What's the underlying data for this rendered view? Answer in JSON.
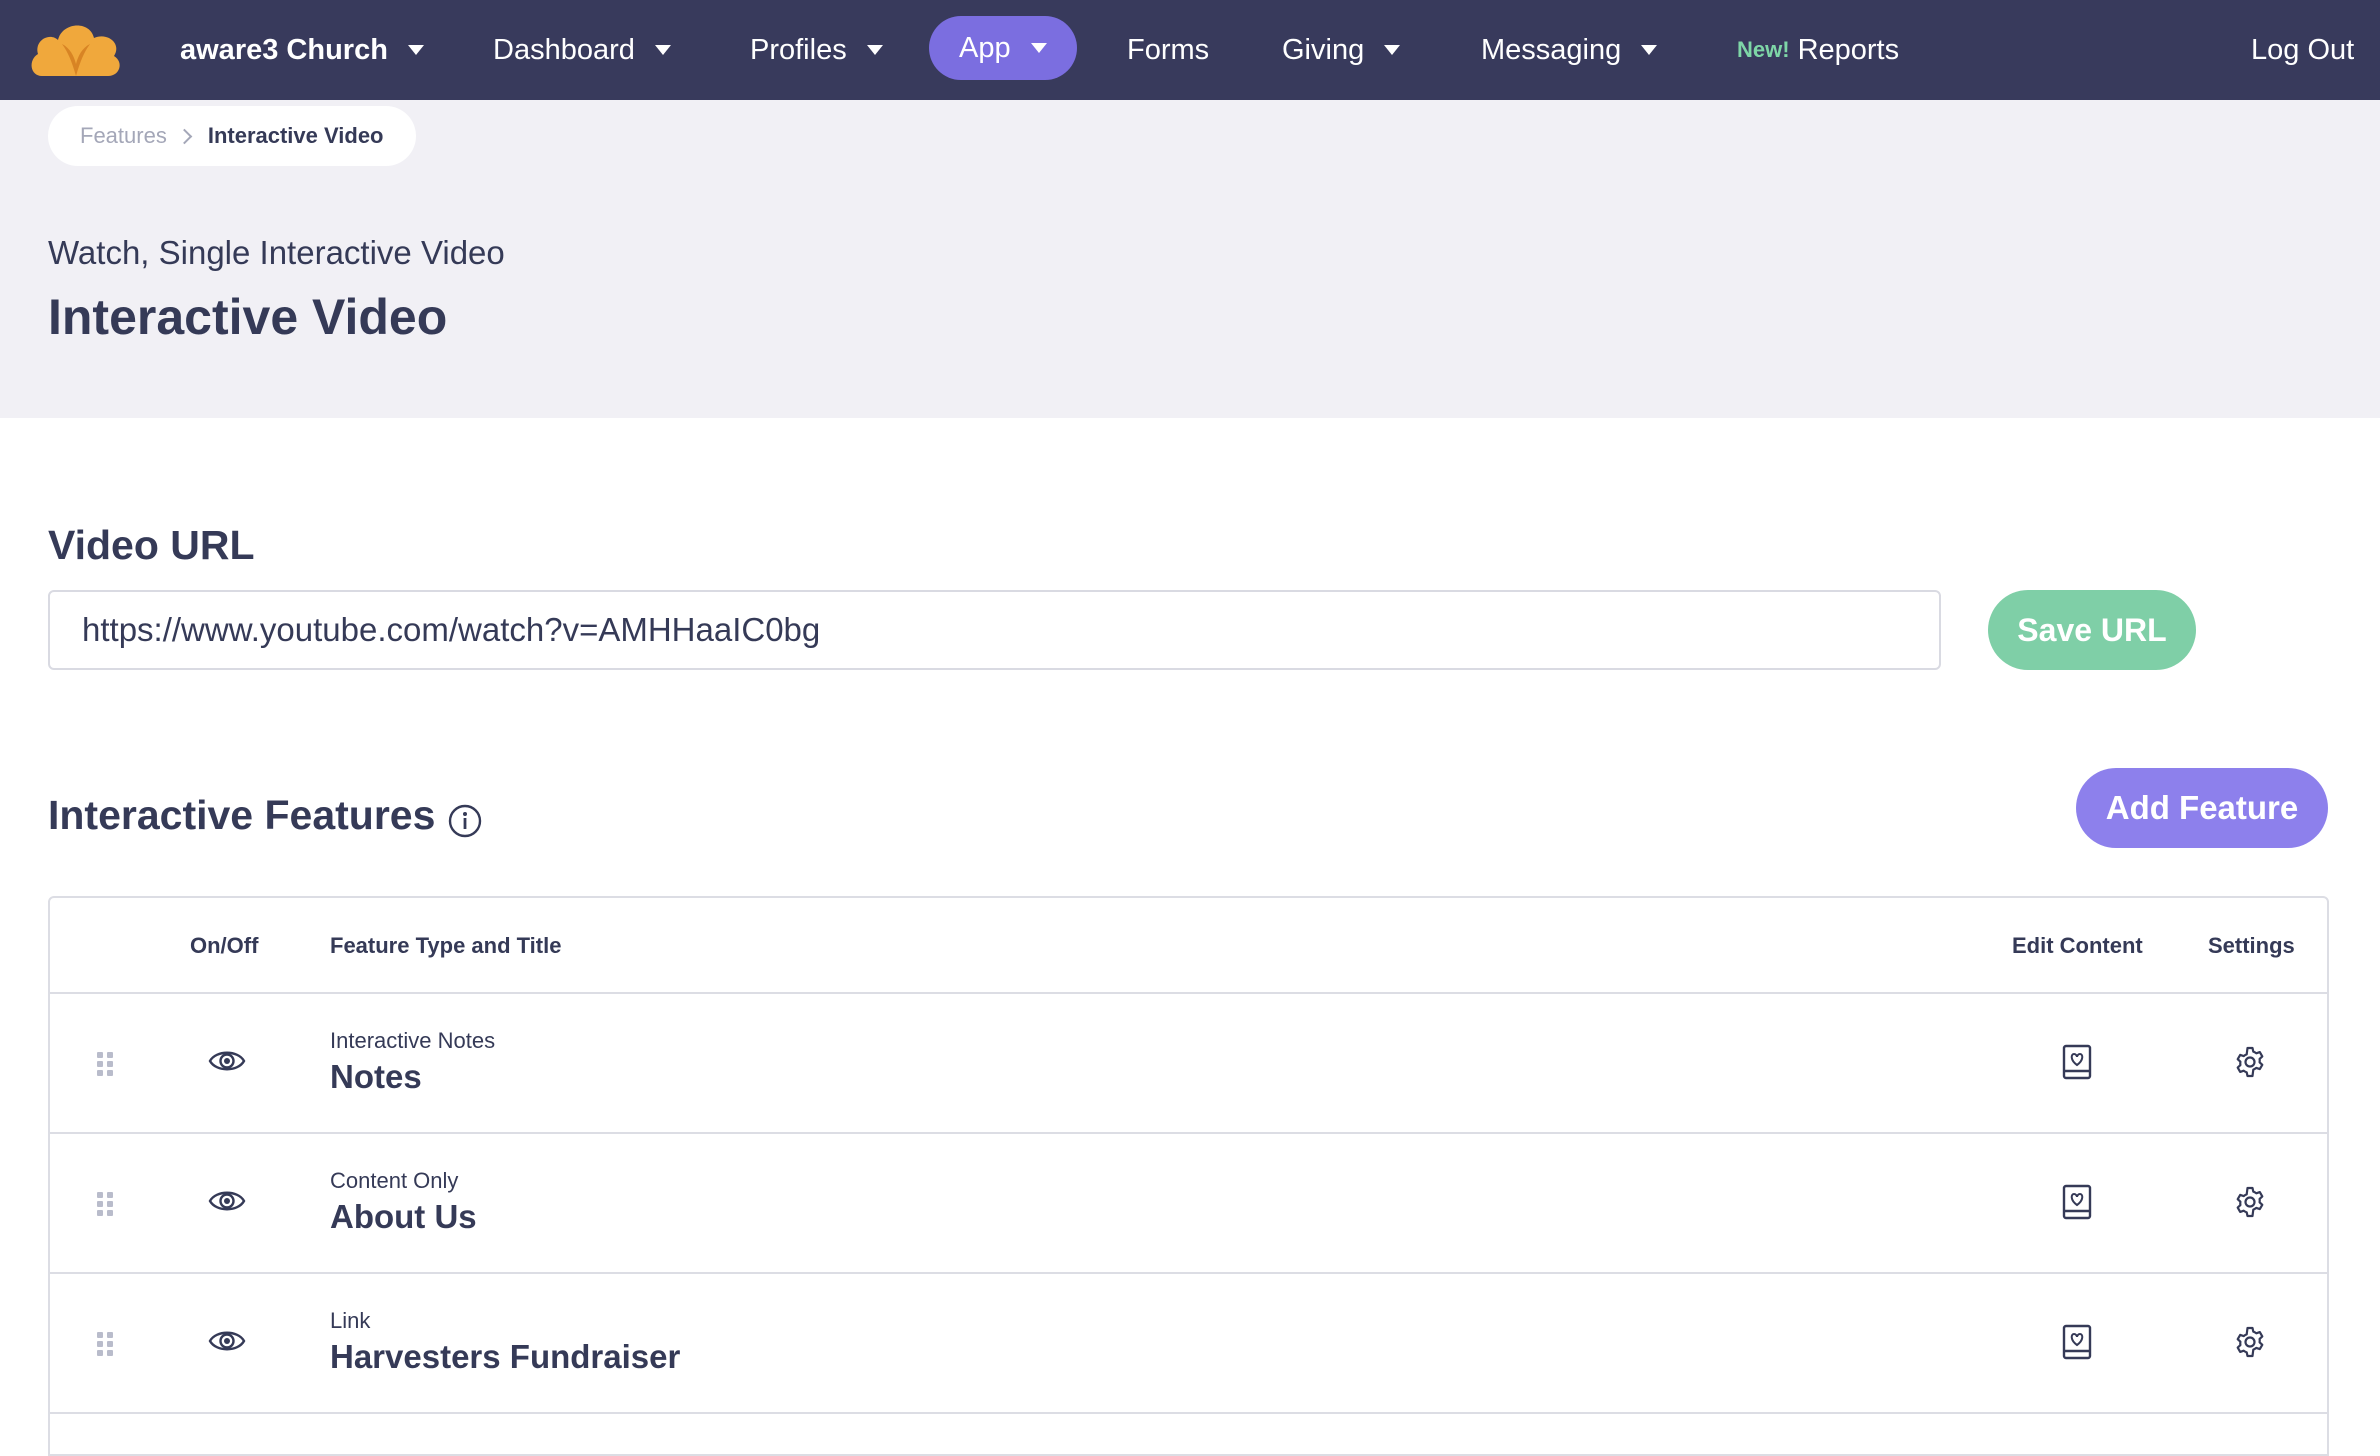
{
  "nav": {
    "church": "aware3 Church",
    "dashboard": "Dashboard",
    "profiles": "Profiles",
    "app": "App",
    "forms": "Forms",
    "giving": "Giving",
    "messaging": "Messaging",
    "new_badge": "New!",
    "reports": "Reports",
    "logout": "Log Out",
    "bg_color": "#383a5c",
    "active_color": "#7b6ee0"
  },
  "breadcrumb": {
    "parent": "Features",
    "current": "Interactive Video"
  },
  "header": {
    "subtitle": "Watch, Single Interactive Video",
    "title": "Interactive Video"
  },
  "video_url": {
    "label": "Video URL",
    "value": "https://www.youtube.com/watch?v=AMHHaaIC0bg",
    "save_label": "Save URL"
  },
  "features": {
    "title": "Interactive Features",
    "add_label": "Add Feature",
    "columns": {
      "onoff": "On/Off",
      "type_title": "Feature Type and Title",
      "edit": "Edit Content",
      "settings": "Settings"
    },
    "rows": [
      {
        "type": "Interactive Notes",
        "title": "Notes"
      },
      {
        "type": "Content Only",
        "title": "About Us"
      },
      {
        "type": "Link",
        "title": "Harvesters Fundraiser"
      }
    ]
  },
  "colors": {
    "save_button": "#7fcfa7",
    "add_button": "#8d80ec",
    "new_badge": "#7ed6a7",
    "text": "#353a57"
  },
  "icons": [
    "cloud-logo-icon",
    "caret-down-icon",
    "chevron-right-icon",
    "info-icon",
    "drag-handle-icon",
    "eye-icon",
    "edit-content-icon",
    "gear-icon"
  ]
}
